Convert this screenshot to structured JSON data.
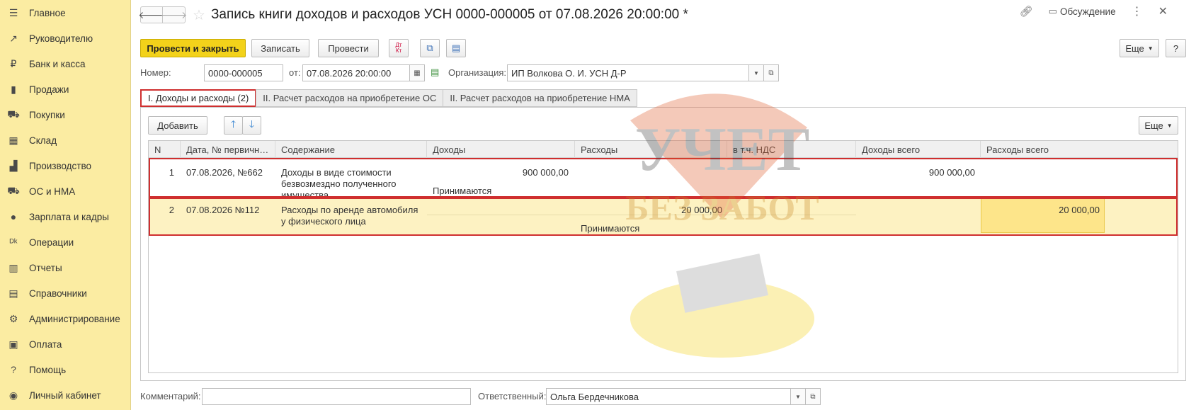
{
  "sidebar": {
    "items": [
      {
        "label": "Главное",
        "icon": "menu-icon",
        "glyph": "☰"
      },
      {
        "label": "Руководителю",
        "icon": "trend-icon",
        "glyph": "↗"
      },
      {
        "label": "Банк и касса",
        "icon": "ruble-coin-icon",
        "glyph": "₽"
      },
      {
        "label": "Продажи",
        "icon": "shopping-bag-icon",
        "glyph": "▮"
      },
      {
        "label": "Покупки",
        "icon": "cart-icon",
        "glyph": "⛟"
      },
      {
        "label": "Склад",
        "icon": "warehouse-icon",
        "glyph": "▦"
      },
      {
        "label": "Производство",
        "icon": "factory-icon",
        "glyph": "▟"
      },
      {
        "label": "ОС и НМА",
        "icon": "truck-icon",
        "glyph": "⛟"
      },
      {
        "label": "Зарплата и кадры",
        "icon": "person-icon",
        "glyph": "●"
      },
      {
        "label": "Операции",
        "icon": "dt-kt-icon",
        "glyph": "ᴰᵏ"
      },
      {
        "label": "Отчеты",
        "icon": "bar-chart-icon",
        "glyph": "▥"
      },
      {
        "label": "Справочники",
        "icon": "books-icon",
        "glyph": "▤"
      },
      {
        "label": "Администрирование",
        "icon": "gear-icon",
        "glyph": "⚙"
      },
      {
        "label": "Оплата",
        "icon": "payment-icon",
        "glyph": "▣"
      },
      {
        "label": "Помощь",
        "icon": "help-icon",
        "glyph": "?"
      },
      {
        "label": "Личный кабинет",
        "icon": "user-circle-icon",
        "glyph": "◉"
      }
    ]
  },
  "header": {
    "title": "Запись книги доходов и расходов УСН 0000-000005 от 07.08.2026 20:00:00 *",
    "discussion_label": "Обсуждение"
  },
  "toolbar": {
    "post_close_label": "Провести и закрыть",
    "save_label": "Записать",
    "post_label": "Провести",
    "dtkt_label": "Дт Кт",
    "more_label": "Еще",
    "help_label": "?"
  },
  "fields": {
    "number_label": "Номер:",
    "number_value": "0000-000005",
    "date_label": "от:",
    "date_value": "07.08.2026 20:00:00",
    "org_label": "Организация:",
    "org_value": "ИП Волкова О. И. УСН Д-Р"
  },
  "tabs": [
    {
      "label": "I. Доходы и расходы (2)"
    },
    {
      "label": "II. Расчет расходов на приобретение ОС"
    },
    {
      "label": "II. Расчет расходов на приобретение НМА"
    }
  ],
  "table_tools": {
    "add_label": "Добавить",
    "more_label": "Еще"
  },
  "table": {
    "columns": [
      "N",
      "Дата, № первично...",
      "Содержание",
      "Доходы",
      "Расходы",
      "в т.ч. НДС",
      "Доходы всего",
      "Расходы всего"
    ],
    "rows": [
      {
        "n": "1",
        "date": "07.08.2026, №662",
        "content": "Доходы в виде стоимости безвозмездно полученного имущества",
        "income": "900 000,00",
        "income_status": "Принимаются",
        "expense": "",
        "expense_status": "",
        "vat": "",
        "income_total": "900 000,00",
        "expense_total": ""
      },
      {
        "n": "2",
        "date": "07.08.2026 №112",
        "content": "Расходы по аренде автомобиля у физического лица",
        "income": "",
        "income_status": "",
        "expense": "20 000,00",
        "expense_status": "Принимаются",
        "vat": "",
        "income_total": "",
        "expense_total": "20 000,00"
      }
    ]
  },
  "watermark": {
    "line1": "УЧЕТ",
    "line2": "БЕЗ ЗАБОТ"
  },
  "footer": {
    "comment_label": "Комментарий:",
    "comment_value": "",
    "responsible_label": "Ответственный:",
    "responsible_value": "Ольга Бердечникова"
  },
  "colors": {
    "sidebar_bg": "#fbeca2",
    "primary_button": "#f3d21a",
    "selected_row": "#fdf2c2",
    "highlight_red": "#cf2f2f"
  }
}
